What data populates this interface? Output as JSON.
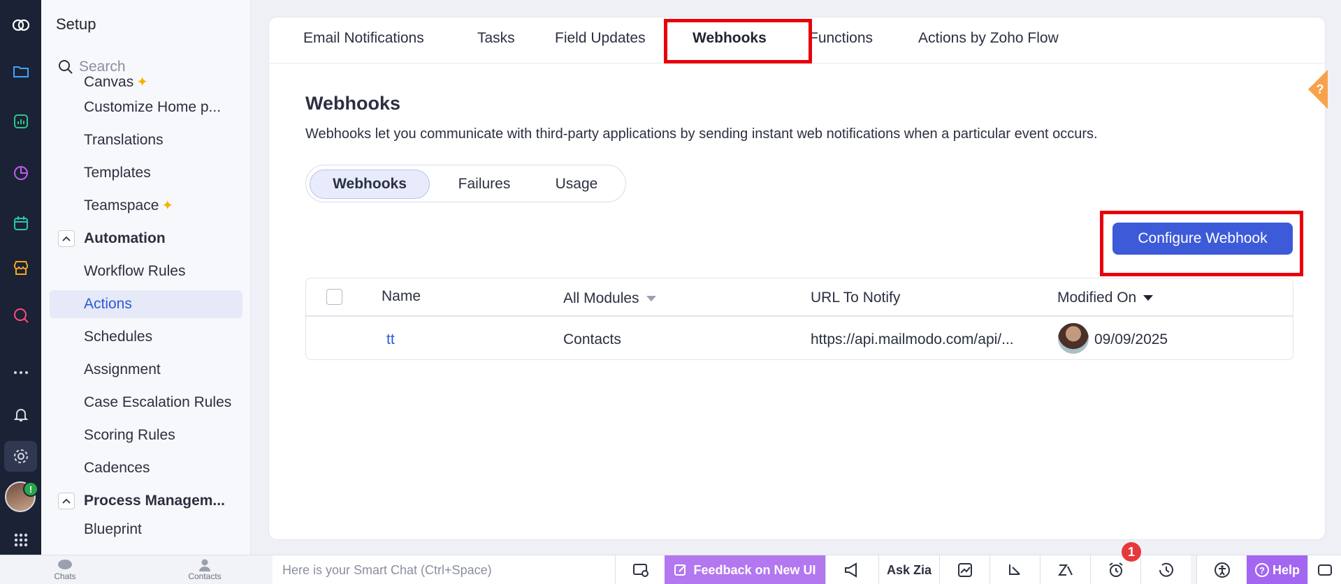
{
  "sidebar": {
    "title": "Setup",
    "search_placeholder": "Search",
    "items": [
      {
        "label": "Canvas"
      },
      {
        "label": "Customize Home p..."
      },
      {
        "label": "Translations"
      },
      {
        "label": "Templates"
      },
      {
        "label": "Teamspace"
      }
    ],
    "automation_group": "Automation",
    "automation_items": [
      {
        "label": "Workflow Rules"
      },
      {
        "label": "Actions"
      },
      {
        "label": "Schedules"
      },
      {
        "label": "Assignment"
      },
      {
        "label": "Case Escalation Rules"
      },
      {
        "label": "Scoring Rules"
      },
      {
        "label": "Cadences"
      }
    ],
    "process_group": "Process Managem...",
    "process_items": [
      {
        "label": "Blueprint"
      }
    ],
    "active_item": "Actions"
  },
  "tabs": [
    {
      "label": "Email Notifications"
    },
    {
      "label": "Tasks"
    },
    {
      "label": "Field Updates"
    },
    {
      "label": "Webhooks"
    },
    {
      "label": "Functions"
    },
    {
      "label": "Actions by Zoho Flow"
    }
  ],
  "active_tab": "Webhooks",
  "content": {
    "title": "Webhooks",
    "description": "Webhooks let you communicate with third-party applications by sending instant web notifications when a particular event occurs.",
    "subtabs": [
      {
        "label": "Webhooks"
      },
      {
        "label": "Failures"
      },
      {
        "label": "Usage"
      }
    ],
    "configure_button": "Configure Webhook"
  },
  "table": {
    "columns": {
      "name": "Name",
      "modules": "All Modules",
      "url": "URL To Notify",
      "modified": "Modified On"
    },
    "rows": [
      {
        "name": "tt",
        "module": "Contacts",
        "url": "https://api.mailmodo.com/api/...",
        "modified": "09/09/2025"
      }
    ]
  },
  "bottombar": {
    "chats": "Chats",
    "contacts": "Contacts",
    "smartchat_placeholder": "Here is your Smart Chat (Ctrl+Space)",
    "feedback": "Feedback on New UI",
    "ask_zia": "Ask Zia",
    "help": "Help",
    "notification_count": "1"
  },
  "colors": {
    "accent": "#3d5ad9",
    "highlight_box": "#e8000c",
    "rail_bg": "#1b2235",
    "feedback_bg": "#b377f0"
  }
}
